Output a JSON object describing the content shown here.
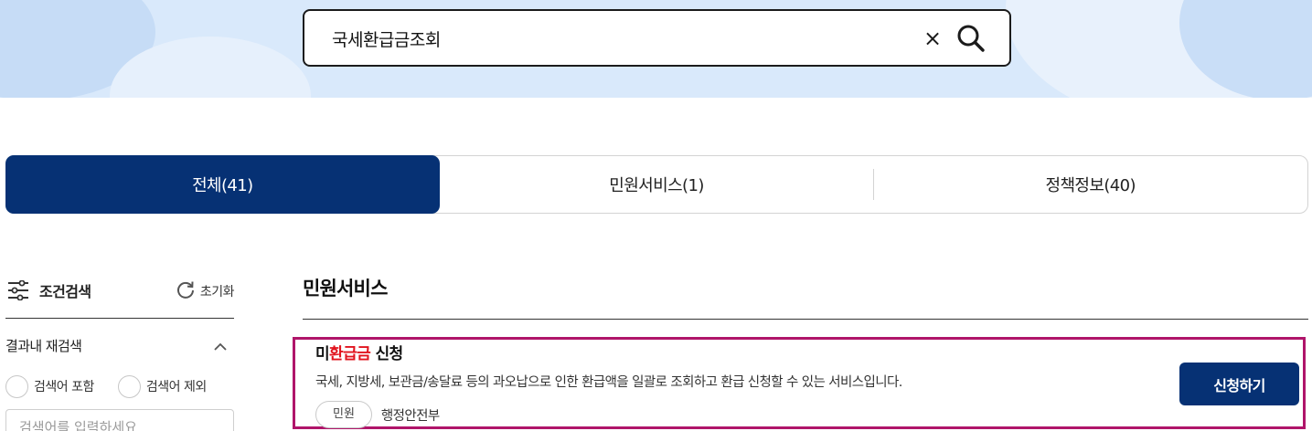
{
  "search": {
    "value": "국세환급금조회",
    "clear_glyph": "×",
    "clear_icon": "close-icon",
    "search_icon": "search-icon"
  },
  "tabs": [
    {
      "label": "전체(41)",
      "active": true
    },
    {
      "label": "민원서비스(1)",
      "active": false
    },
    {
      "label": "정책정보(40)",
      "active": false
    }
  ],
  "filter": {
    "title": "조건검색",
    "title_icon": "sliders-icon",
    "reset_label": "초기화",
    "reset_icon": "refresh-icon",
    "research_label": "결과내 재검색",
    "research_icon": "chevron-up-icon",
    "options": [
      "검색어 포함",
      "검색어 제외"
    ],
    "input_placeholder": "검색어를 입력하세요"
  },
  "results": {
    "section_title": "민원서비스",
    "items": [
      {
        "title_prefix": "미",
        "title_highlight": "환급금",
        "title_suffix": " 신청",
        "description": "국세, 지방세, 보관금/송달료 등의 과오납으로 인한 환급액을 일괄로 조회하고 환급 신청할 수 있는 서비스입니다.",
        "badge": "민원",
        "agency": "행정안전부",
        "action_label": "신청하기"
      }
    ]
  },
  "colors": {
    "primary": "#063174",
    "highlight": "#e1141e",
    "card_border": "#b0156a",
    "hero_bg": "#d9e9fb"
  }
}
